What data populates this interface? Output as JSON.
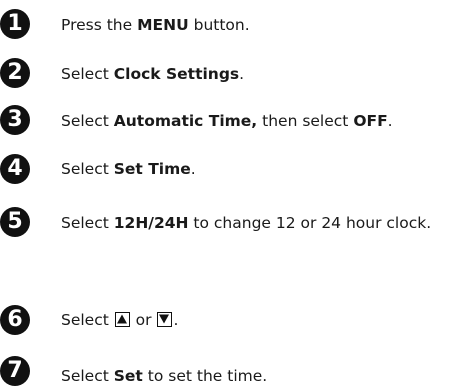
{
  "steps": [
    {
      "number": "1",
      "parts": [
        "Press the ",
        "MENU",
        " button."
      ]
    },
    {
      "number": "2",
      "parts": [
        "Select ",
        "Clock Settings",
        "."
      ]
    },
    {
      "number": "3",
      "parts": [
        "Select ",
        "Automatic Time,",
        " then select ",
        "OFF",
        "."
      ]
    },
    {
      "number": "4",
      "parts": [
        "Select ",
        "Set Time",
        "."
      ]
    },
    {
      "number": "5",
      "parts": [
        "Select ",
        "12H/24H",
        " to change 12 or 24 hour clock."
      ]
    },
    {
      "number": "6",
      "parts": [
        "Select ",
        " or ",
        "."
      ],
      "icons": [
        "up-triangle-icon",
        "down-triangle-icon"
      ]
    },
    {
      "number": "7",
      "parts": [
        "Select ",
        "Set",
        " to set the time."
      ]
    }
  ]
}
